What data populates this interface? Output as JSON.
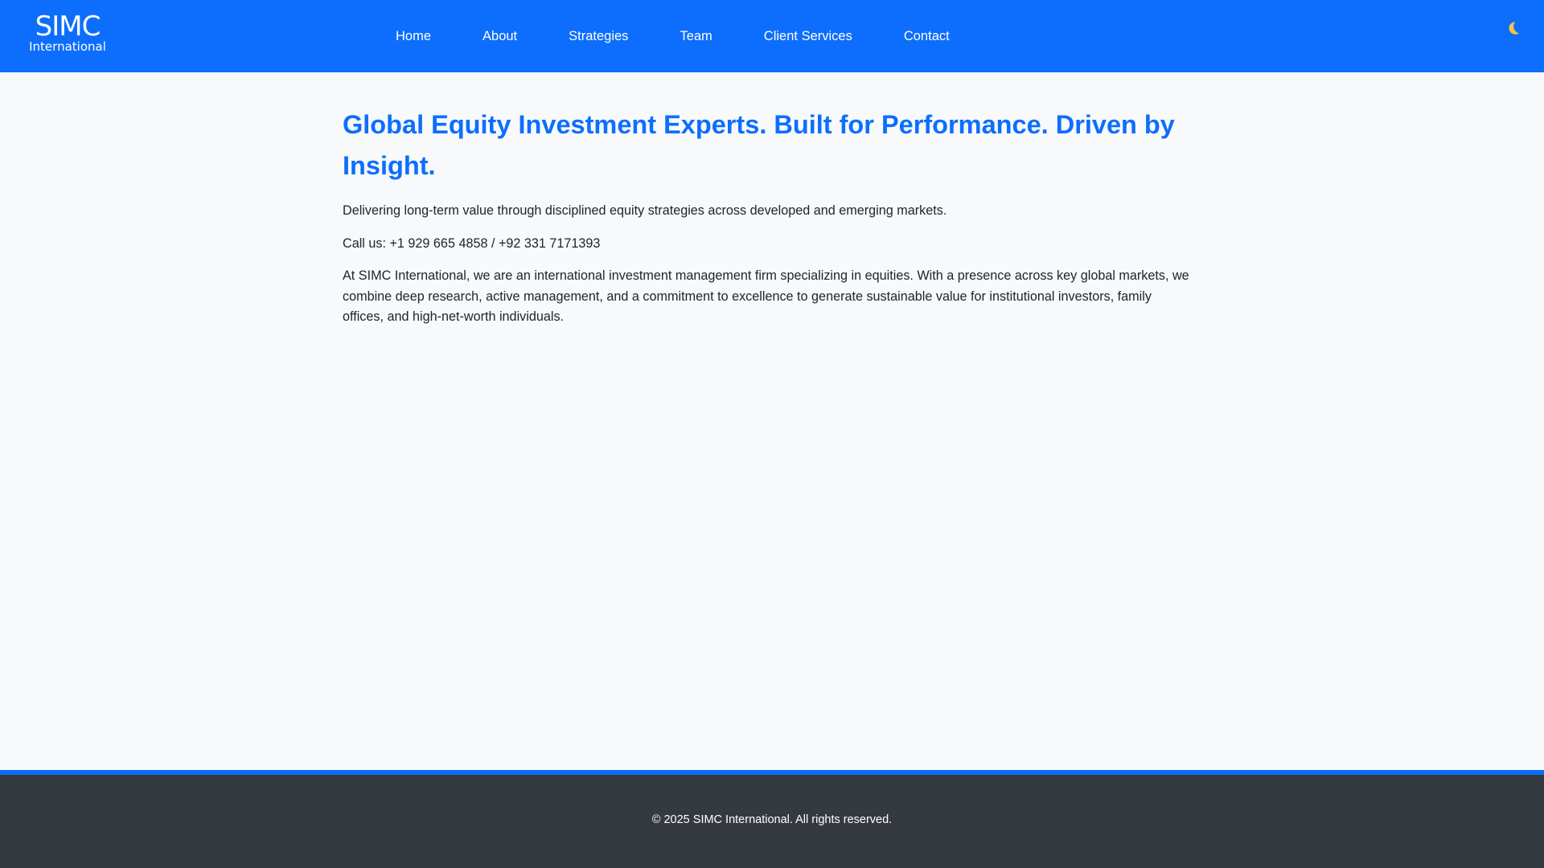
{
  "brand": {
    "name": "SIMC",
    "subtitle": "International"
  },
  "nav": {
    "items": [
      {
        "label": "Home"
      },
      {
        "label": "About"
      },
      {
        "label": "Strategies"
      },
      {
        "label": "Team"
      },
      {
        "label": "Client Services"
      },
      {
        "label": "Contact"
      }
    ],
    "theme_toggle_icon": "moon-icon"
  },
  "hero": {
    "headline": "Global Equity Investment Experts. Built for Performance. Driven by Insight.",
    "tagline": "Delivering long-term value through disciplined equity strategies across developed and emerging markets.",
    "phone": "Call us: +1 929 665 4858 / +92 331 7171393",
    "description": "At SIMC International, we are an international investment management firm specializing in equities. With a presence across key global markets, we combine deep research, active management, and a commitment to excellence to generate sustainable value for institutional investors, family offices, and high-net-worth individuals."
  },
  "footer": {
    "copyright": "© 2025 SIMC International. All rights reserved."
  },
  "colors": {
    "primary": "#0d6efd",
    "page_background": "#f7f9fb",
    "text": "#212529",
    "footer_background": "#343a40",
    "moon": "#f5c542"
  }
}
